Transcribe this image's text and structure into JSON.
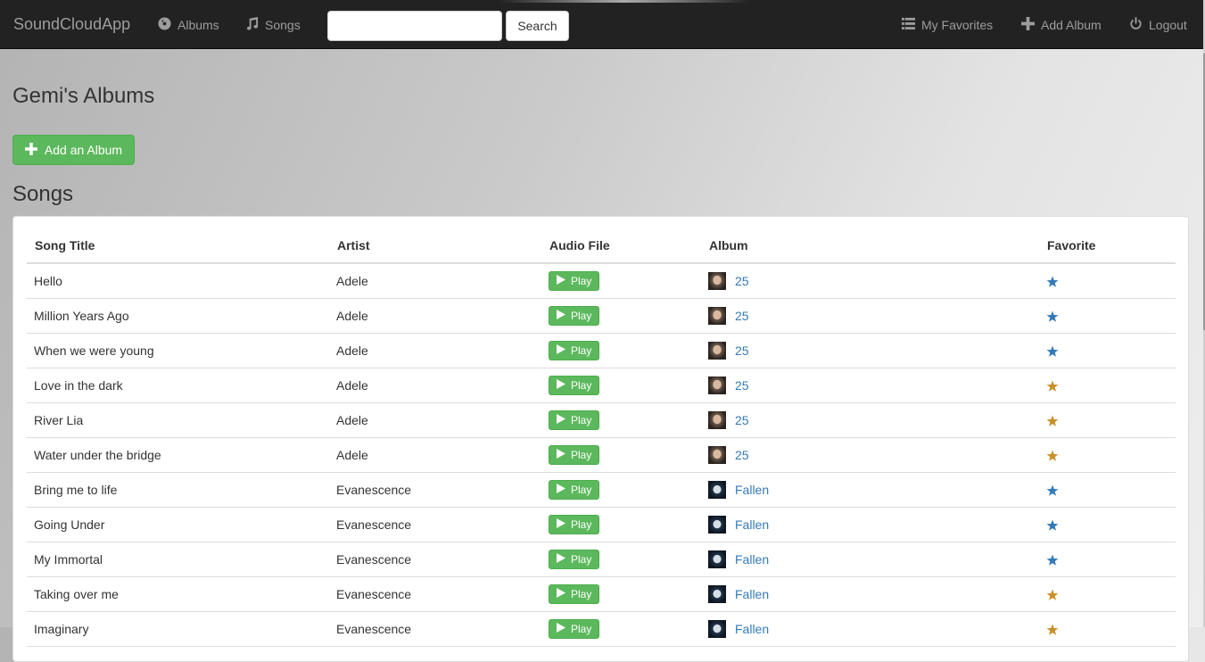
{
  "navbar": {
    "brand": "SoundCloudApp",
    "albums_label": "Albums",
    "songs_label": "Songs",
    "search_value": "",
    "search_button": "Search",
    "favorites_label": "My Favorites",
    "add_album_label": "Add Album",
    "logout_label": "Logout"
  },
  "page": {
    "title": "Gemi's Albums",
    "add_album_button": "Add an Album",
    "songs_heading": "Songs"
  },
  "colors": {
    "star_default": "#337ab7",
    "star_favorite": "#c8912a",
    "success": "#5cb85c",
    "link": "#337ab7"
  },
  "table": {
    "headers": [
      "Song Title",
      "Artist",
      "Audio File",
      "Album",
      "Favorite"
    ],
    "play_label": "Play",
    "rows": [
      {
        "title": "Hello",
        "artist": "Adele",
        "album": "25",
        "cover": "cover-25",
        "favorite": false
      },
      {
        "title": "Million Years Ago",
        "artist": "Adele",
        "album": "25",
        "cover": "cover-25",
        "favorite": false
      },
      {
        "title": "When we were young",
        "artist": "Adele",
        "album": "25",
        "cover": "cover-25",
        "favorite": false
      },
      {
        "title": "Love in the dark",
        "artist": "Adele",
        "album": "25",
        "cover": "cover-25",
        "favorite": true
      },
      {
        "title": "River Lia",
        "artist": "Adele",
        "album": "25",
        "cover": "cover-25",
        "favorite": true
      },
      {
        "title": "Water under the bridge",
        "artist": "Adele",
        "album": "25",
        "cover": "cover-25",
        "favorite": true
      },
      {
        "title": "Bring me to life",
        "artist": "Evanescence",
        "album": "Fallen",
        "cover": "cover-fallen",
        "favorite": false
      },
      {
        "title": "Going Under",
        "artist": "Evanescence",
        "album": "Fallen",
        "cover": "cover-fallen",
        "favorite": false
      },
      {
        "title": "My Immortal",
        "artist": "Evanescence",
        "album": "Fallen",
        "cover": "cover-fallen",
        "favorite": false
      },
      {
        "title": "Taking over me",
        "artist": "Evanescence",
        "album": "Fallen",
        "cover": "cover-fallen",
        "favorite": true
      },
      {
        "title": "Imaginary",
        "artist": "Evanescence",
        "album": "Fallen",
        "cover": "cover-fallen",
        "favorite": true
      }
    ]
  }
}
